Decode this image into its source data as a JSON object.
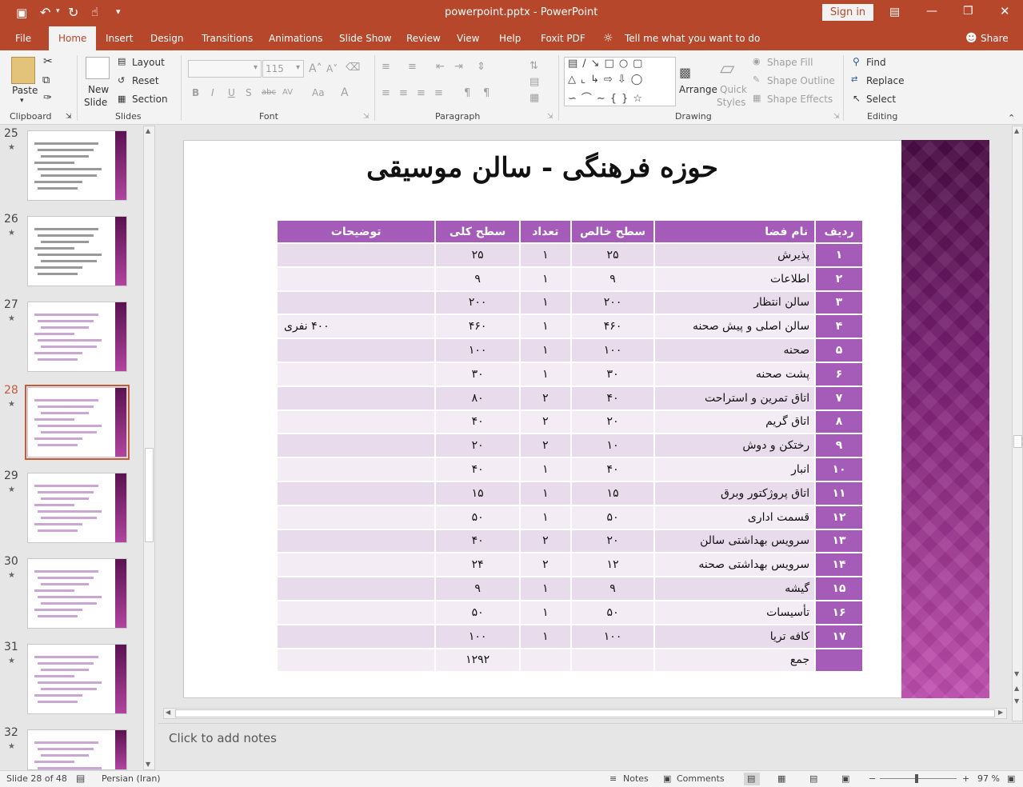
{
  "window": {
    "title": "powerpoint.pptx  -  PowerPoint",
    "sign_in": "Sign in",
    "minimize": "—",
    "restore": "❐",
    "close": "✕",
    "quick_access": {
      "save": "💾",
      "undo": "↶",
      "redo": "↻",
      "touch": "☝",
      "customize": "▾"
    }
  },
  "tabs": [
    "File",
    "Home",
    "Insert",
    "Design",
    "Transitions",
    "Animations",
    "Slide Show",
    "Review",
    "View",
    "Help",
    "Foxit PDF"
  ],
  "tell_me": "Tell me what you want to do",
  "share": "Share",
  "ribbon": {
    "clipboard": {
      "label": "Clipboard",
      "paste": "Paste"
    },
    "slides": {
      "label": "Slides",
      "new_slide_1": "New",
      "new_slide_2": "Slide",
      "layout": "Layout",
      "reset": "Reset",
      "section": "Section"
    },
    "font": {
      "label": "Font",
      "size": "115",
      "grow": "A˄",
      "shrink": "A˅",
      "bold": "B",
      "italic": "I",
      "underline": "U",
      "shadow": "S",
      "strike": "abc",
      "spacing": "AV",
      "case": "Aa",
      "color": "A"
    },
    "paragraph": {
      "label": "Paragraph"
    },
    "drawing": {
      "label": "Drawing",
      "arrange": "Arrange",
      "quick_styles_1": "Quick",
      "quick_styles_2": "Styles",
      "shape_fill": "Shape Fill",
      "shape_outline": "Shape Outline",
      "shape_effects": "Shape Effects"
    },
    "editing": {
      "label": "Editing",
      "find": "Find",
      "replace": "Replace",
      "select": "Select"
    }
  },
  "thumbnails": [
    {
      "num": "25",
      "star": "★"
    },
    {
      "num": "26",
      "star": "★"
    },
    {
      "num": "27",
      "star": "★"
    },
    {
      "num": "28",
      "star": "★"
    },
    {
      "num": "29",
      "star": "★"
    },
    {
      "num": "30",
      "star": "★"
    },
    {
      "num": "31",
      "star": "★"
    },
    {
      "num": "32",
      "star": "★"
    }
  ],
  "slide": {
    "title": "حوزه فرهنگی - سالن موسیقی",
    "headers": [
      "ردیف",
      "نام فضا",
      "سطح خالص",
      "تعداد",
      "سطح کلی",
      "توضیحات"
    ],
    "rows": [
      [
        "۱",
        "پذیرش",
        "۲۵",
        "۱",
        "۲۵",
        ""
      ],
      [
        "۲",
        "اطلاعات",
        "۹",
        "۱",
        "۹",
        ""
      ],
      [
        "۳",
        "سالن انتظار",
        "۲۰۰",
        "۱",
        "۲۰۰",
        ""
      ],
      [
        "۴",
        "سالن اصلی و پیش صحنه",
        "۴۶۰",
        "۱",
        "۴۶۰",
        "۴۰۰ نفری"
      ],
      [
        "۵",
        "صحنه",
        "۱۰۰",
        "۱",
        "۱۰۰",
        ""
      ],
      [
        "۶",
        "پشت صحنه",
        "۳۰",
        "۱",
        "۳۰",
        ""
      ],
      [
        "۷",
        "اتاق تمرین و استراحت",
        "۴۰",
        "۲",
        "۸۰",
        ""
      ],
      [
        "۸",
        "اتاق گریم",
        "۲۰",
        "۲",
        "۴۰",
        ""
      ],
      [
        "۹",
        "رختکن و دوش",
        "۱۰",
        "۲",
        "۲۰",
        ""
      ],
      [
        "۱۰",
        "انبار",
        "۴۰",
        "۱",
        "۴۰",
        ""
      ],
      [
        "۱۱",
        "اتاق پروژکتور وبرق",
        "۱۵",
        "۱",
        "۱۵",
        ""
      ],
      [
        "۱۲",
        "قسمت اداری",
        "۵۰",
        "۱",
        "۵۰",
        ""
      ],
      [
        "۱۳",
        "سرویس بهداشتی سالن",
        "۲۰",
        "۲",
        "۴۰",
        ""
      ],
      [
        "۱۴",
        "سرویس بهداشتی صحنه",
        "۱۲",
        "۲",
        "۲۴",
        ""
      ],
      [
        "۱۵",
        "گیشه",
        "۹",
        "۱",
        "۹",
        ""
      ],
      [
        "۱۶",
        "تأسیسات",
        "۵۰",
        "۱",
        "۵۰",
        ""
      ],
      [
        "۱۷",
        "کافه تریا",
        "۱۰۰",
        "۱",
        "۱۰۰",
        ""
      ],
      [
        "",
        "جمع",
        "",
        "",
        "۱۲۹۲",
        ""
      ]
    ]
  },
  "notes_placeholder": "Click to add notes",
  "status": {
    "slide_of": "Slide 28 of 48",
    "language": "Persian (Iran)",
    "notes": "Notes",
    "comments": "Comments",
    "zoom": "97 %",
    "minus": "−",
    "plus": "+"
  },
  "colors": {
    "accent": "#b7472a",
    "table_header": "#a45cb8",
    "row_a": "#e8dbec",
    "row_b": "#f3ecf5"
  }
}
